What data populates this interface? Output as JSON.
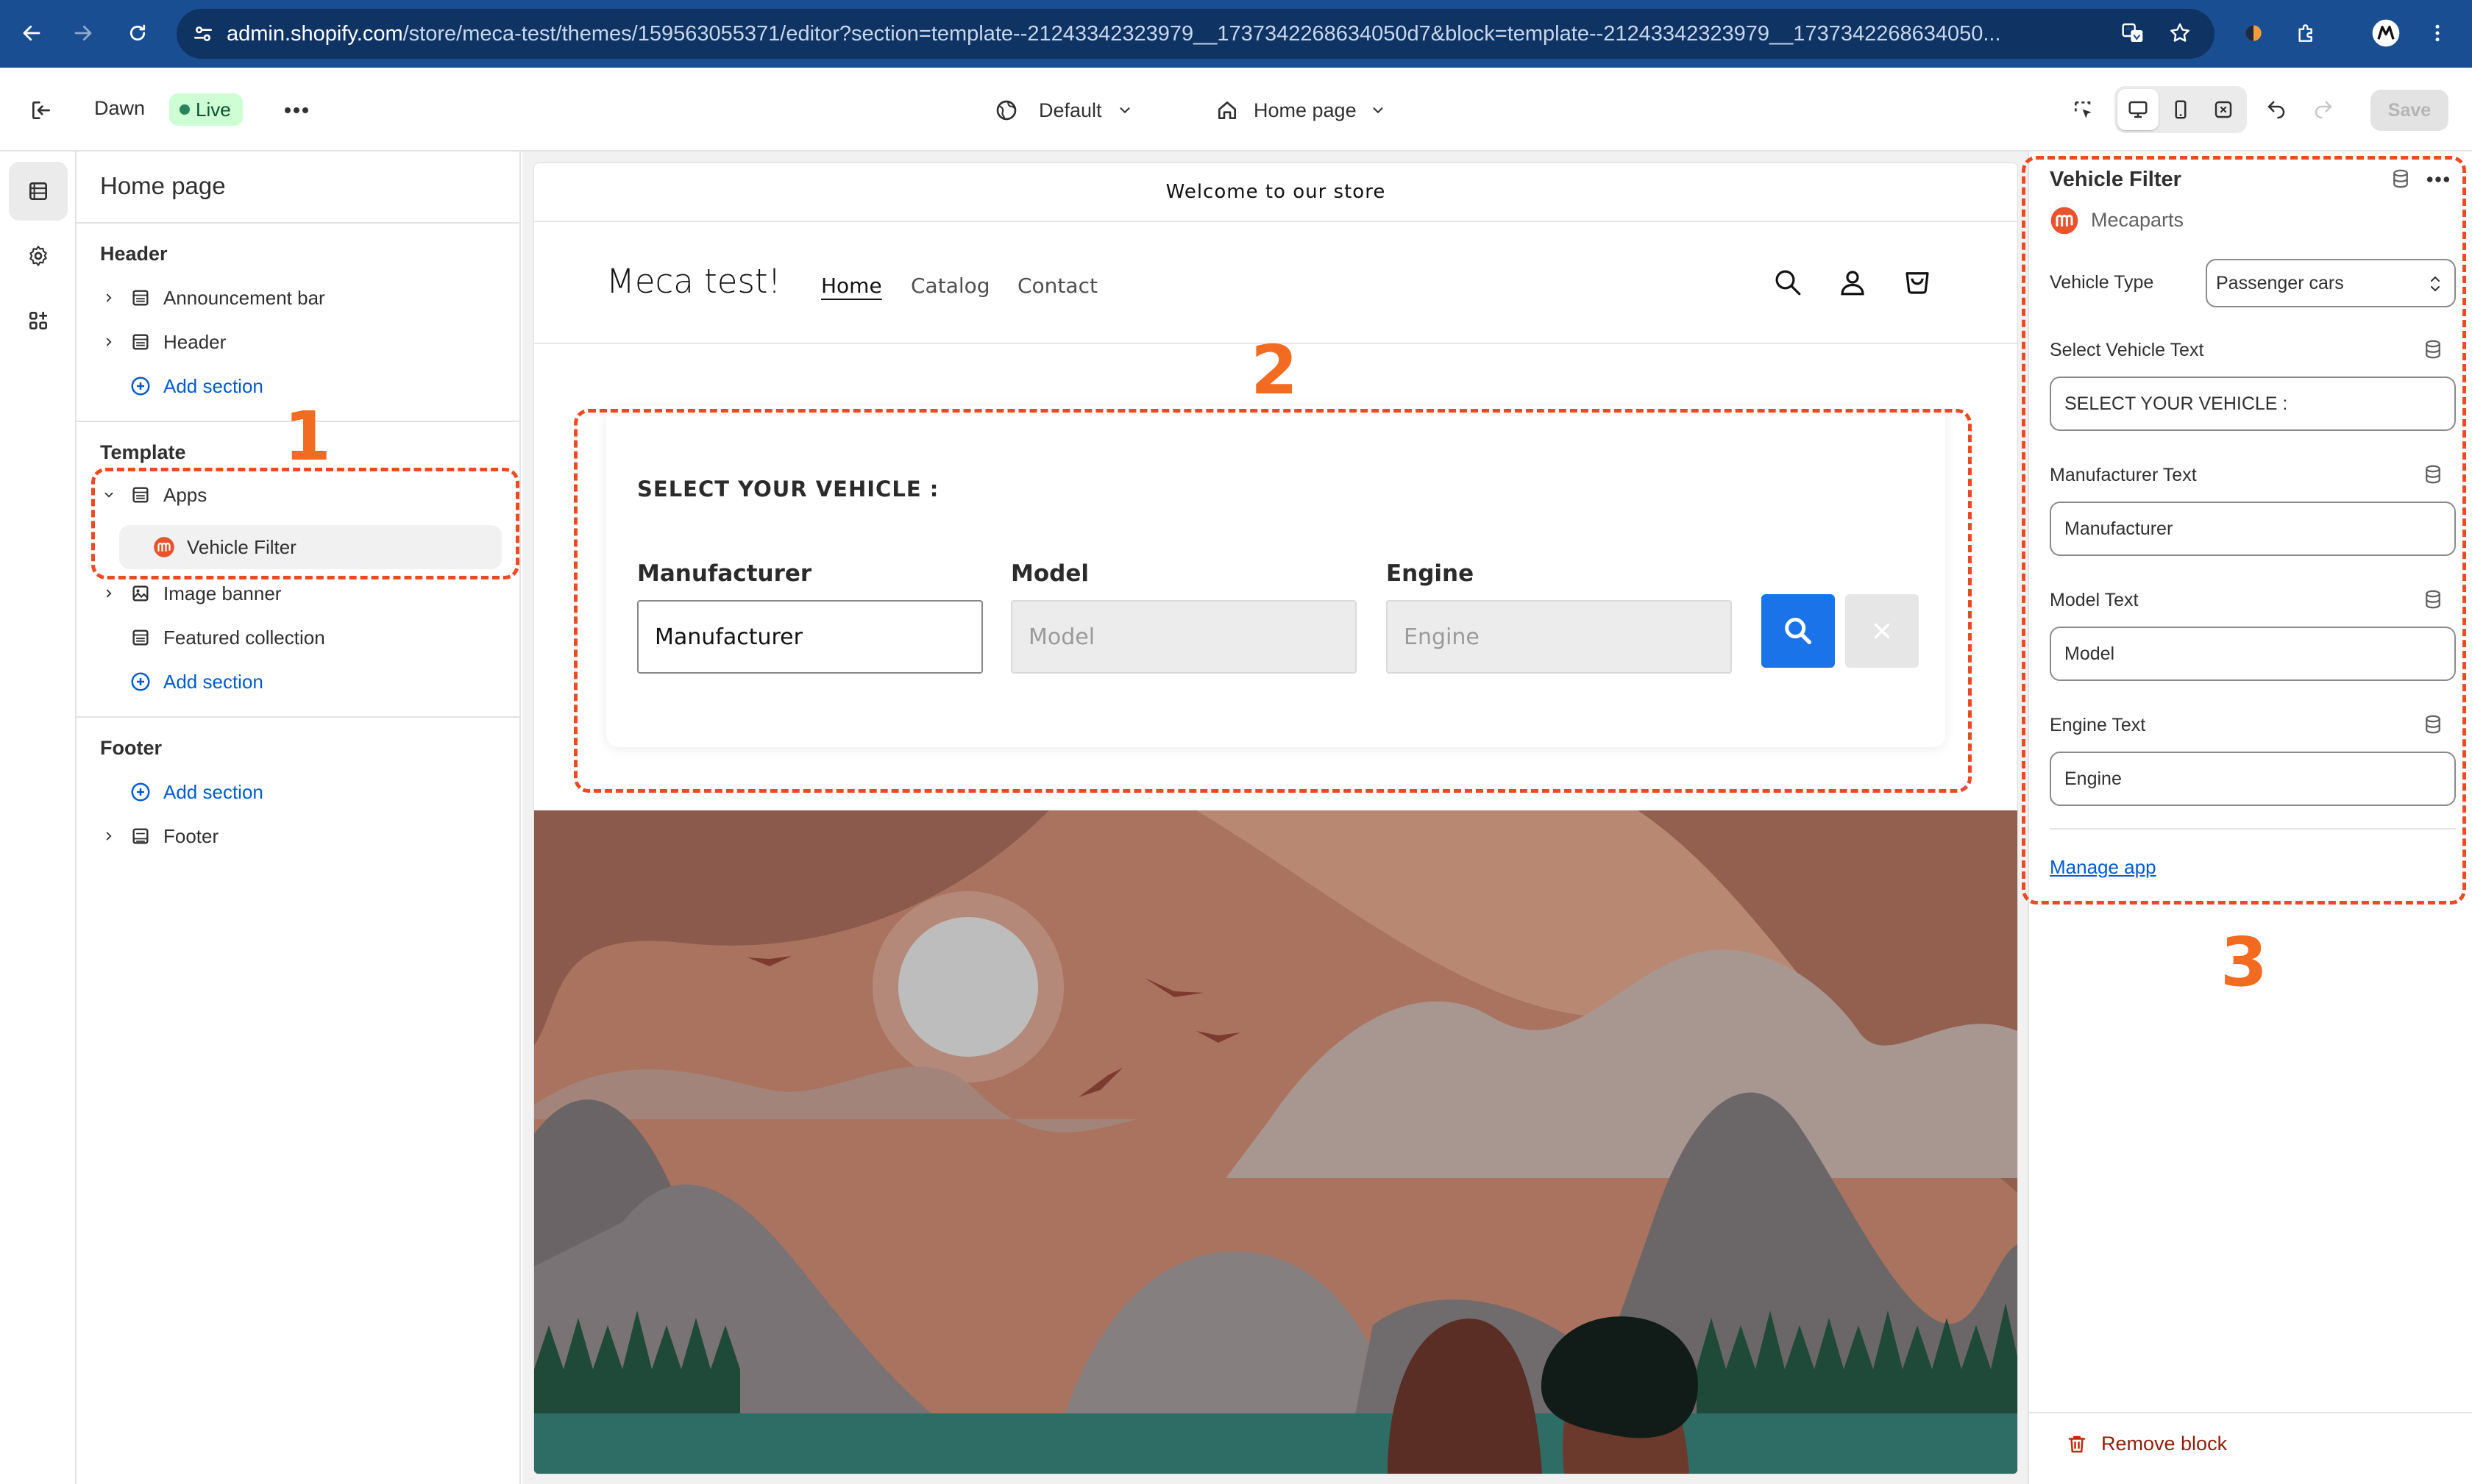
{
  "browser": {
    "url_host": "admin.shopify.com",
    "url_path": "/store/meca-test/themes/159563055371/editor?section=template--21243342323979__1737342268634050d7&block=template--21243342323979__1737342268634050..."
  },
  "topbar": {
    "theme_name": "Dawn",
    "live_badge": "Live",
    "theme_preset": "Default",
    "page_select": "Home page",
    "save_label": "Save"
  },
  "left_panel": {
    "title": "Home page",
    "header_group": "Header",
    "header_items": [
      "Announcement bar",
      "Header"
    ],
    "add_section": "Add section",
    "template_group": "Template",
    "apps_item": "Apps",
    "vehicle_filter_item": "Vehicle Filter",
    "template_items": [
      "Image banner",
      "Featured collection"
    ],
    "footer_group": "Footer",
    "footer_item": "Footer"
  },
  "preview": {
    "announcement": "Welcome to our store",
    "store_name": "Meca test!",
    "nav": [
      "Home",
      "Catalog",
      "Contact"
    ],
    "vehicle_filter": {
      "heading": "SELECT YOUR VEHICLE :",
      "labels": [
        "Manufacturer",
        "Model",
        "Engine"
      ],
      "fields": [
        "Manufacturer",
        "Model",
        "Engine"
      ]
    }
  },
  "right_panel": {
    "title": "Vehicle Filter",
    "app_name": "Mecaparts",
    "vehicle_type_label": "Vehicle Type",
    "vehicle_type_value": "Passenger cars",
    "select_vehicle_text_label": "Select Vehicle Text",
    "select_vehicle_text_value": "SELECT YOUR VEHICLE :",
    "manufacturer_text_label": "Manufacturer Text",
    "manufacturer_text_value": "Manufacturer",
    "model_text_label": "Model Text",
    "model_text_value": "Model",
    "engine_text_label": "Engine Text",
    "engine_text_value": "Engine",
    "manage_app": "Manage app",
    "remove_block": "Remove block"
  },
  "annotations": [
    "1",
    "2",
    "3"
  ],
  "colors": {
    "chrome_bar": "#1a4e92",
    "accent_blue": "#005bd3",
    "search_button": "#1a73e8",
    "annotation": "#ee4a22",
    "app_logo": "#e8532b"
  }
}
